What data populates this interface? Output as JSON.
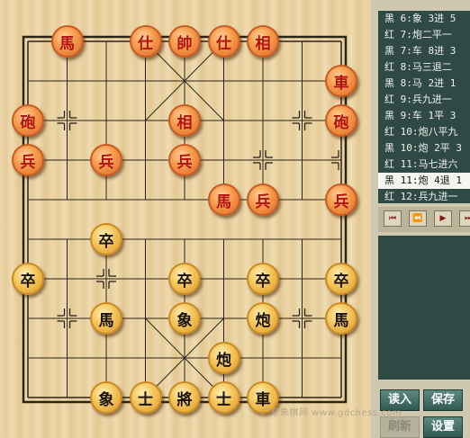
{
  "board": {
    "pieces": [
      {
        "side": "red",
        "char": "馬",
        "file": 1,
        "rank": 0
      },
      {
        "side": "red",
        "char": "仕",
        "file": 3,
        "rank": 0
      },
      {
        "side": "red",
        "char": "帥",
        "file": 4,
        "rank": 0
      },
      {
        "side": "red",
        "char": "仕",
        "file": 5,
        "rank": 0
      },
      {
        "side": "red",
        "char": "相",
        "file": 6,
        "rank": 0
      },
      {
        "side": "red",
        "char": "車",
        "file": 8,
        "rank": 1
      },
      {
        "side": "red",
        "char": "砲",
        "file": 0,
        "rank": 2
      },
      {
        "side": "red",
        "char": "相",
        "file": 4,
        "rank": 2
      },
      {
        "side": "red",
        "char": "砲",
        "file": 8,
        "rank": 2
      },
      {
        "side": "red",
        "char": "兵",
        "file": 0,
        "rank": 3
      },
      {
        "side": "red",
        "char": "兵",
        "file": 2,
        "rank": 3
      },
      {
        "side": "red",
        "char": "兵",
        "file": 4,
        "rank": 3
      },
      {
        "side": "red",
        "char": "馬",
        "file": 5,
        "rank": 4
      },
      {
        "side": "red",
        "char": "兵",
        "file": 6,
        "rank": 4
      },
      {
        "side": "red",
        "char": "兵",
        "file": 8,
        "rank": 4
      },
      {
        "side": "black",
        "char": "卒",
        "file": 2,
        "rank": 5
      },
      {
        "side": "black",
        "char": "卒",
        "file": 0,
        "rank": 6
      },
      {
        "side": "black",
        "char": "卒",
        "file": 4,
        "rank": 6
      },
      {
        "side": "black",
        "char": "卒",
        "file": 6,
        "rank": 6
      },
      {
        "side": "black",
        "char": "卒",
        "file": 8,
        "rank": 6
      },
      {
        "side": "black",
        "char": "馬",
        "file": 2,
        "rank": 7
      },
      {
        "side": "black",
        "char": "象",
        "file": 4,
        "rank": 7
      },
      {
        "side": "black",
        "char": "炮",
        "file": 6,
        "rank": 7
      },
      {
        "side": "black",
        "char": "馬",
        "file": 8,
        "rank": 7
      },
      {
        "side": "black",
        "char": "炮",
        "file": 5,
        "rank": 8
      },
      {
        "side": "black",
        "char": "象",
        "file": 2,
        "rank": 9
      },
      {
        "side": "black",
        "char": "士",
        "file": 3,
        "rank": 9
      },
      {
        "side": "black",
        "char": "將",
        "file": 4,
        "rank": 9
      },
      {
        "side": "black",
        "char": "士",
        "file": 5,
        "rank": 9
      },
      {
        "side": "black",
        "char": "車",
        "file": 6,
        "rank": 9
      }
    ]
  },
  "move_list": {
    "selected_index": 9,
    "items": [
      "黑  6:象 3进 5",
      "红  7:炮二平一",
      "黑  7:车 8进 3",
      "红  8:马三退二",
      "黑  8:马 2进 1",
      "红  9:兵九进一",
      "黑  9:车 1平 3",
      "红 10:炮八平九",
      "黑 10:炮 2平 3",
      "红 11:马七进六",
      "黑 11:炮 4退 1",
      "红 12:兵九进一"
    ]
  },
  "nav": {
    "first": "⏮",
    "prev": "⏪",
    "next": "▶",
    "last": "⏭"
  },
  "buttons": {
    "load": "读入",
    "save": "保存",
    "refresh": "刷新",
    "settings": "设置"
  },
  "watermark": "广东象棋网 www.gdchess.com"
}
